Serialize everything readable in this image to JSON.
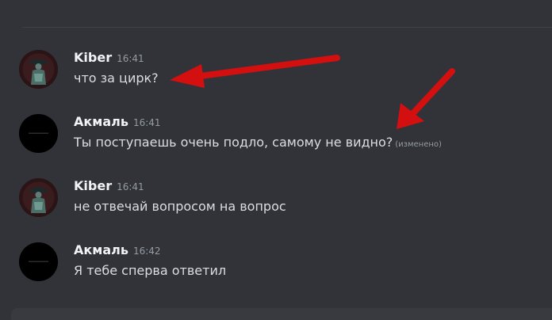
{
  "messages": [
    {
      "author": "Kiber",
      "time": "16:41",
      "text": "что за цирк?",
      "avatar_icon": "kiber-avatar",
      "name_color": "#f2f3f5"
    },
    {
      "author": "Акмаль",
      "time": "16:41",
      "text": "Ты поступаешь очень подло, самому не видно?",
      "edited_label": "(изменено)",
      "avatar_icon": "akmal-avatar",
      "name_color": "#f2f3f5"
    },
    {
      "author": "Kiber",
      "time": "16:41",
      "text": "не отвечай вопросом на вопрос",
      "avatar_icon": "kiber-avatar",
      "name_color": "#f2f3f5"
    },
    {
      "author": "Акмаль",
      "time": "16:42",
      "text": "Я тебе сперва ответил",
      "avatar_icon": "akmal-avatar",
      "name_color": "#f2f3f5"
    }
  ],
  "annotations": {
    "arrow_color": "#d40f0f",
    "arrows": [
      {
        "icon": "red-arrow-icon",
        "points_to": "что за цирк?"
      },
      {
        "icon": "red-arrow-icon",
        "points_to": "Ты поступаешь очень подло, самому не видно?"
      }
    ]
  },
  "colors": {
    "background": "#313338",
    "message_text": "#dbdee1",
    "timestamp": "#949ba4",
    "composer": "#383a40"
  }
}
